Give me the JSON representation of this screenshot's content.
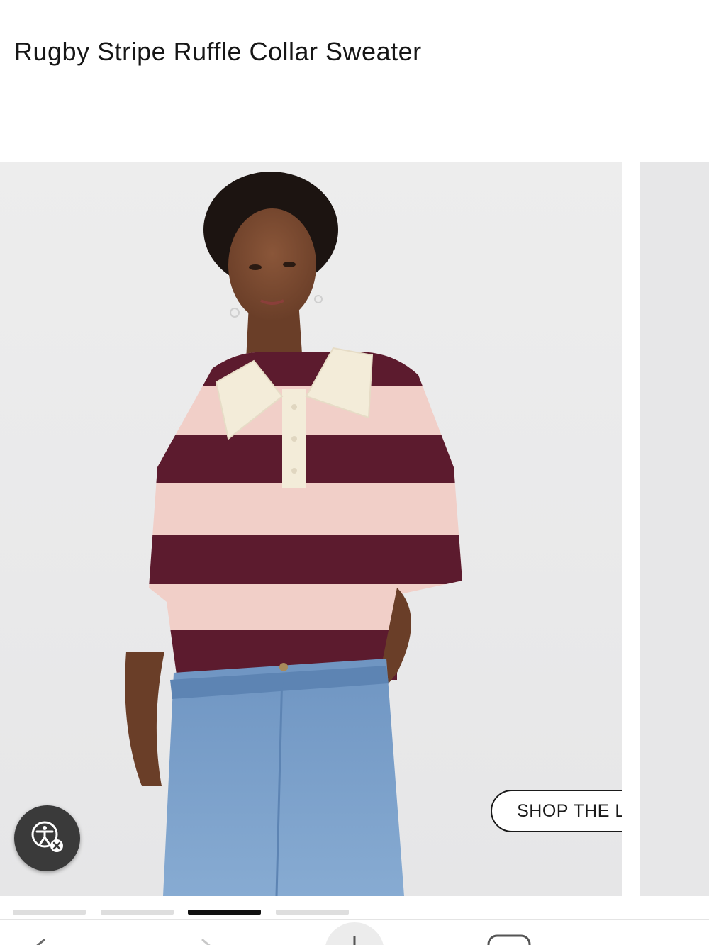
{
  "product": {
    "title": "Rugby Stripe Ruffle Collar Sweater"
  },
  "gallery": {
    "shop_the_look_label": "SHOP THE LOOK",
    "image_alt": "Model wearing the rugby stripe ruffle collar sweater with light-wash jeans",
    "slide_count": 4,
    "active_slide": 3
  },
  "accessibility_button": {
    "icon": "accessibility-icon"
  },
  "bottom_nav": {
    "items": [
      {
        "icon": "back-icon"
      },
      {
        "icon": "forward-icon"
      },
      {
        "icon": "new-tab-icon"
      },
      {
        "icon": "tabs-icon"
      }
    ]
  },
  "colors": {
    "stripe_dark": "#5c1b2e",
    "stripe_light": "#f1cfc8",
    "collar": "#f3ecd9",
    "denim": "#7aa0c8"
  }
}
